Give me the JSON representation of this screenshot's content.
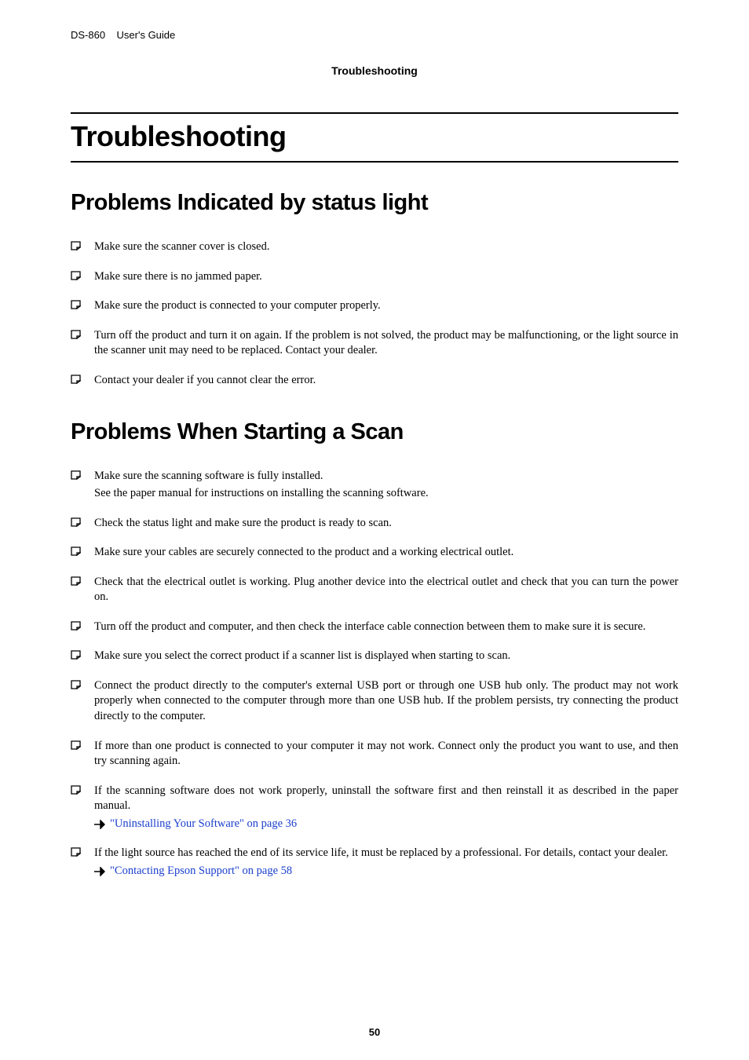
{
  "header": {
    "product": "DS-860",
    "doc_title": "User's Guide",
    "section": "Troubleshooting"
  },
  "h1": "Troubleshooting",
  "section1": {
    "title": "Problems Indicated by status light",
    "items": [
      {
        "text": "Make sure the scanner cover is closed."
      },
      {
        "text": "Make sure there is no jammed paper."
      },
      {
        "text": "Make sure the product is connected to your computer properly."
      },
      {
        "text": "Turn off the product and turn it on again. If the problem is not solved, the product may be malfunctioning, or the light source in the scanner unit may need to be replaced. Contact your dealer."
      },
      {
        "text": "Contact your dealer if you cannot clear the error."
      }
    ]
  },
  "section2": {
    "title": "Problems When Starting a Scan",
    "items": [
      {
        "text": "Make sure the scanning software is fully installed.",
        "sub": "See the paper manual for instructions on installing the scanning software."
      },
      {
        "text": "Check the status light and make sure the product is ready to scan."
      },
      {
        "text": "Make sure your cables are securely connected to the product and a working electrical outlet."
      },
      {
        "text": "Check that the electrical outlet is working. Plug another device into the electrical outlet and check that you can turn the power on."
      },
      {
        "text": "Turn off the product and computer, and then check the interface cable connection between them to make sure it is secure."
      },
      {
        "text": "Make sure you select the correct product if a scanner list is displayed when starting to scan."
      },
      {
        "text": "Connect the product directly to the computer's external USB port or through one USB hub only. The product may not work properly when connected to the computer through more than one USB hub. If the problem persists, try connecting the product directly to the computer."
      },
      {
        "text": "If more than one product is connected to your computer it may not work. Connect only the product you want to use, and then try scanning again."
      },
      {
        "text": "If the scanning software does not work properly, uninstall the software first and then reinstall it as described in the paper manual.",
        "link": "\"Uninstalling Your Software\" on page 36"
      },
      {
        "text": "If the light source has reached the end of its service life, it must be replaced by a professional. For details, contact your dealer.",
        "link": "\"Contacting Epson Support\" on page 58"
      }
    ]
  },
  "page_number": "50"
}
